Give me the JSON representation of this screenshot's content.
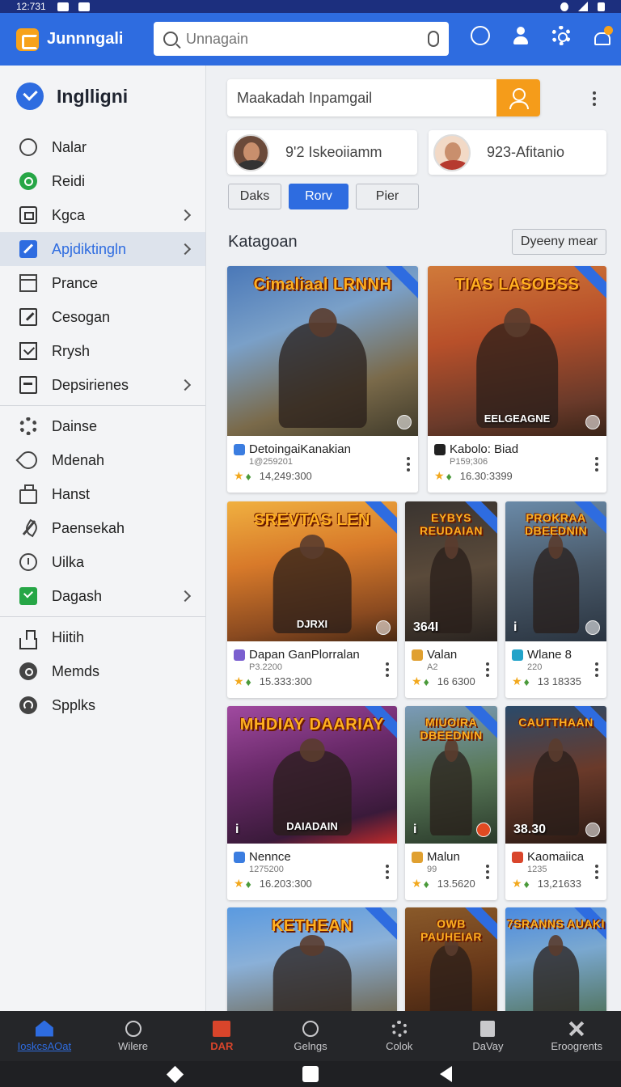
{
  "status_bar": {
    "time": "12:731"
  },
  "app_bar": {
    "title": "Junnngali",
    "search_placeholder": "Unnagain"
  },
  "sidebar": {
    "title": "Inglligni",
    "groups": [
      [
        {
          "label": "Nalar",
          "icon": "circle-icon"
        },
        {
          "label": "Reidi",
          "icon": "green-circle-icon"
        },
        {
          "label": "Kgca",
          "icon": "box-icon",
          "chevron": true
        },
        {
          "label": "Apjdiktingln",
          "icon": "pencil-icon",
          "chevron": true,
          "active": true
        },
        {
          "label": "Prance",
          "icon": "frame-icon"
        },
        {
          "label": "Cesogan",
          "icon": "edit-icon"
        },
        {
          "label": "Rrysh",
          "icon": "checkbox-icon"
        },
        {
          "label": "Depsirienes",
          "icon": "bar-icon",
          "chevron": true
        }
      ],
      [
        {
          "label": "Dainse",
          "icon": "gear-icon"
        },
        {
          "label": "Mdenah",
          "icon": "link-icon"
        },
        {
          "label": "Hanst",
          "icon": "bag-icon"
        },
        {
          "label": "Paensekah",
          "icon": "quill-icon"
        },
        {
          "label": "Uilka",
          "icon": "dial-icon"
        },
        {
          "label": "Dagash",
          "icon": "green-check-icon",
          "chevron": true
        }
      ],
      [
        {
          "label": "Hiitih",
          "icon": "tray-icon"
        },
        {
          "label": "Memds",
          "icon": "dot-icon"
        },
        {
          "label": "Spplks",
          "icon": "arc-icon"
        }
      ]
    ]
  },
  "main": {
    "search_value": "Maakadah Inpamgail",
    "profiles": [
      {
        "label": "9'2 Iskeoiiamm"
      },
      {
        "label": "923-Afitanio"
      }
    ],
    "tabs": [
      {
        "label": "Daks",
        "active": false
      },
      {
        "label": "Rorv",
        "active": true
      },
      {
        "label": "Pier",
        "active": false
      }
    ],
    "section_title": "Katagoan",
    "sort_label": "Dyeeny mear",
    "cards": [
      {
        "art_title": "Cimaliaal LRNNH",
        "art_sub": "",
        "corner": "",
        "name": "DetoingaiKanakian",
        "sub": "1@259201",
        "stats": "14,249:300",
        "mini": "#3b7de0",
        "badge": "grey"
      },
      {
        "art_title": "TIAS LASOBSS",
        "art_sub": "EELGEAGNE",
        "corner": "",
        "name": "Kabolo: Biad",
        "sub": "P159;306",
        "stats": "16.30:3399",
        "mini": "#222",
        "badge": "grey"
      },
      {
        "art_title": "SREVTAS LEN",
        "art_sub": "DJRXI",
        "corner": "",
        "name": "Dapan GanPlorralan",
        "sub": "P3.2200",
        "stats": "15.333:300",
        "mini": "#7a5fcf",
        "badge": "grey"
      },
      {
        "art_title": "EYBYS REUDAIAN",
        "art_sub": "",
        "corner": "364I",
        "name": "Valan",
        "sub": "A2",
        "stats": "16 6300",
        "mini": "#e0a030",
        "badge": "none"
      },
      {
        "art_title": "PROKRAA DBEEDNIN",
        "art_sub": "",
        "corner": "i",
        "name": "Wlane 8",
        "sub": "220",
        "stats": "13 18335",
        "mini": "#22a3c9",
        "badge": "grey"
      },
      {
        "art_title": "MHDIAY DAARIAY",
        "art_sub": "DAIADAIN",
        "corner": "i",
        "name": "Nennce",
        "sub": "1275200",
        "stats": "16.203:300",
        "mini": "#3b7de0",
        "badge": "none"
      },
      {
        "art_title": "MIUOIRA DBEEDNIN",
        "art_sub": "",
        "corner": "i",
        "name": "Malun",
        "sub": "99",
        "stats": "13.5620",
        "mini": "#e0a030",
        "badge": "red"
      },
      {
        "art_title": "CAUTTHAAN",
        "art_sub": "",
        "corner": "38.30",
        "name": "Kaomaiica",
        "sub": "1235",
        "stats": "13,21633",
        "mini": "#d9452b",
        "badge": "grey"
      },
      {
        "art_title": "KETHEAN",
        "art_sub": "",
        "corner": "",
        "name": "",
        "sub": "",
        "stats": "",
        "mini": "#3b7de0",
        "badge": "none"
      },
      {
        "art_title": "OWB PAUHEIAR",
        "art_sub": "",
        "corner": "",
        "name": "",
        "sub": "",
        "stats": "",
        "mini": "#e0a030",
        "badge": "none"
      },
      {
        "art_title": "7SRANNS AUAKI",
        "art_sub": "",
        "corner": "",
        "name": "",
        "sub": "",
        "stats": "",
        "mini": "#22a3c9",
        "badge": "none"
      }
    ]
  },
  "bottom_nav": [
    {
      "label": "IoskcsAOat",
      "icon": "home-icon",
      "active": true
    },
    {
      "label": "Wilere",
      "icon": "clock-icon"
    },
    {
      "label": "DAR",
      "icon": "red-plus-icon",
      "red": true
    },
    {
      "label": "Gelngs",
      "icon": "search-icon"
    },
    {
      "label": "Colok",
      "icon": "gear-icon"
    },
    {
      "label": "DaVay",
      "icon": "gift-icon"
    },
    {
      "label": "Eroogrents",
      "icon": "cross-icon"
    }
  ]
}
